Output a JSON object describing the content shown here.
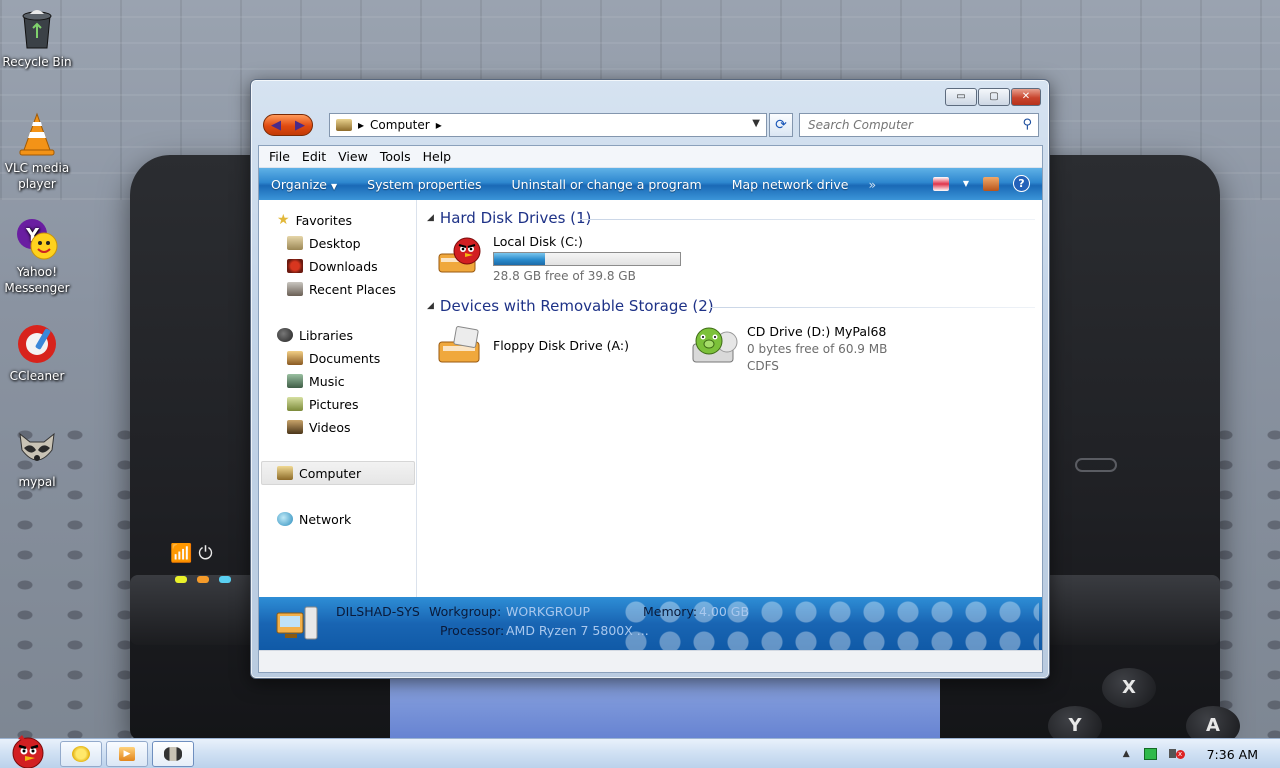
{
  "desktop": {
    "icons": [
      {
        "label": "Recycle Bin",
        "icon": "recycle-bin-icon"
      },
      {
        "label": "VLC media player",
        "icon": "vlc-cone-icon"
      },
      {
        "label": "Yahoo! Messenger",
        "icon": "yahoo-messenger-icon"
      },
      {
        "label": "CCleaner",
        "icon": "ccleaner-icon"
      },
      {
        "label": "mypal",
        "icon": "raccoon-icon"
      }
    ]
  },
  "window": {
    "caption_buttons": {
      "minimize": "▭",
      "maximize": "▢",
      "close": "✕"
    },
    "address": {
      "location": "Computer",
      "separator": "▸"
    },
    "search": {
      "placeholder": "Search Computer"
    },
    "menu": [
      "File",
      "Edit",
      "View",
      "Tools",
      "Help"
    ],
    "commands": {
      "organize": "Organize",
      "system_properties": "System properties",
      "uninstall": "Uninstall or change a program",
      "map_drive": "Map network drive",
      "more": "»",
      "help": "?"
    },
    "nav": {
      "favorites": "Favorites",
      "desktop": "Desktop",
      "downloads": "Downloads",
      "recent": "Recent Places",
      "libraries": "Libraries",
      "documents": "Documents",
      "music": "Music",
      "pictures": "Pictures",
      "videos": "Videos",
      "computer": "Computer",
      "network": "Network"
    },
    "groups": {
      "hdd": {
        "title": "Hard Disk Drives (1)",
        "drives": [
          {
            "name": "Local Disk (C:)",
            "free": "28.8 GB free of 39.8 GB",
            "used_fraction": 0.276
          }
        ]
      },
      "removable": {
        "title": "Devices with Removable Storage (2)",
        "drives": [
          {
            "name": "Floppy Disk Drive (A:)"
          },
          {
            "name": "CD Drive (D:) MyPal68",
            "free": "0 bytes free of 60.9 MB",
            "fs": "CDFS"
          }
        ]
      }
    },
    "details": {
      "computer_name": "DILSHAD-SYS",
      "workgroup_label": "Workgroup:",
      "workgroup_value": "WORKGROUP",
      "memory_label": "Memory:",
      "memory_value": "4.00 GB",
      "processor_label": "Processor:",
      "processor_value": "AMD Ryzen 7 5800X ..."
    }
  },
  "taskbar": {
    "clock": "7:36 AM",
    "tray_arrow": "▲"
  },
  "colors": {
    "command_bar": "#2e87cf",
    "group_title": "#1e3287",
    "close_button": "#c8452e"
  }
}
